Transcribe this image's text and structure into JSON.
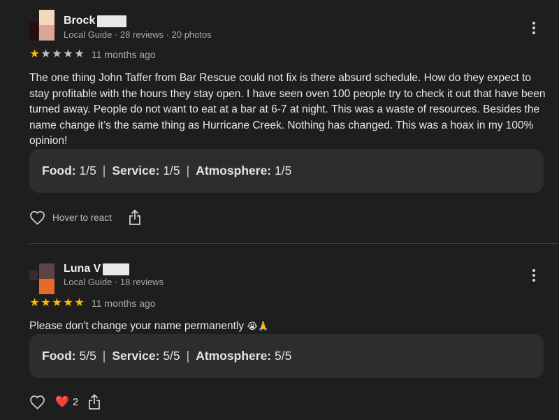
{
  "reviews": [
    {
      "name": "Brock",
      "meta": "Local Guide · 28 reviews · 20 photos",
      "rating": 1,
      "stars": [
        "★",
        "★",
        "★",
        "★",
        "★"
      ],
      "time": "11 months ago",
      "text": "The one thing John Taffer from Bar Rescue could not fix is there absurd schedule. How do they expect to stay profitable with the hours they stay open. I have seen oven 100 people try to check it out that have been turned away. People do not want to eat at a bar at 6-7 at night. This was a waste of resources. Besides the name change it’s the same thing as Hurricane Creek. Nothing has changed. This was a hoax in my 100% opinion!",
      "ratings": {
        "food_label": "Food:",
        "food_value": "1/5",
        "service_label": "Service:",
        "service_value": "1/5",
        "atmosphere_label": "Atmosphere:",
        "atmosphere_value": "1/5",
        "separator": "|"
      },
      "hover_react": "Hover to react",
      "avatar_colors": [
        "#f6d7b8",
        "#d8a596",
        "#3a1010"
      ]
    },
    {
      "name": "Luna V",
      "meta": "Local Guide · 18 reviews",
      "rating": 5,
      "stars": [
        "★",
        "★",
        "★",
        "★",
        "★"
      ],
      "time": "11 months ago",
      "text": "Please don't change your name permanently",
      "emoji": "😭🙏",
      "ratings": {
        "food_label": "Food:",
        "food_value": "5/5",
        "service_label": "Service:",
        "service_value": "5/5",
        "atmosphere_label": "Atmosphere:",
        "atmosphere_value": "5/5",
        "separator": "|"
      },
      "reaction_emoji": "❤️",
      "reaction_count": "2",
      "avatar_colors": [
        "#5a4448",
        "#e76a2c",
        "#3a2a2c"
      ]
    }
  ],
  "icons": {
    "more": "more-vert-icon",
    "heart": "heart-outline-icon",
    "share": "share-icon"
  },
  "colors": {
    "background": "#1e1e1e",
    "card": "#2c2d2f",
    "star": "#fbbc04",
    "star_off": "#bdc1c6"
  }
}
